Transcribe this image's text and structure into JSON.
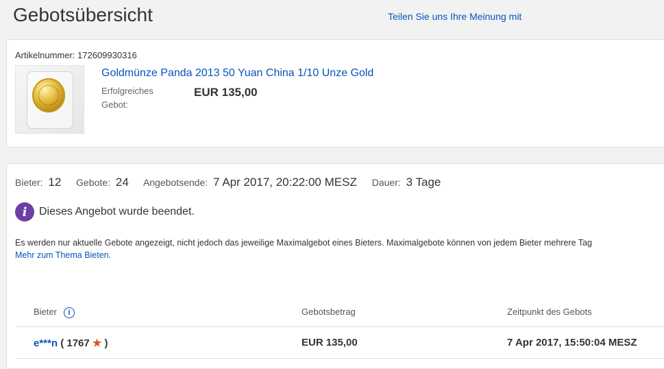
{
  "header": {
    "title": "Gebotsübersicht",
    "feedback_link": "Teilen Sie uns Ihre Meinung mit"
  },
  "item": {
    "number_label": "Artikelnummer: 172609930316",
    "title": "Goldmünze Panda 2013 50 Yuan China 1/10 Unze Gold",
    "sold_label": "Erfolgreiches Gebot:",
    "sold_price": "EUR 135,00"
  },
  "stats": {
    "bidders_label": "Bieter:",
    "bidders_value": "12",
    "bids_label": "Gebote:",
    "bids_value": "24",
    "end_label": "Angebotsende:",
    "end_value": "7 Apr 2017, 20:22:00 MESZ",
    "duration_label": "Dauer:",
    "duration_value": "3 Tage"
  },
  "status": {
    "message": "Dieses Angebot wurde beendet."
  },
  "note": {
    "text": "Es werden nur aktuelle Gebote angezeigt, nicht jedoch das jeweilige Maximalgebot eines Bieters. Maximalgebote können von jedem Bieter mehrere Tag",
    "link": "Mehr zum Thema Bieten."
  },
  "table": {
    "headers": {
      "bidder": "Bieter",
      "amount": "Gebotsbetrag",
      "time": "Zeitpunkt des Gebots"
    },
    "rows": [
      {
        "bidder": "e***n",
        "feedback_open": "(",
        "feedback": "1767",
        "feedback_close": ")",
        "amount": "EUR 135,00",
        "time": "7 Apr 2017, 15:50:04 MESZ"
      }
    ]
  },
  "colors": {
    "link": "#0654ba",
    "info_icon": "#6c3fa6",
    "star": "#d9531e",
    "gold": "#e8c145"
  },
  "icons": {
    "status": "info-circle-icon",
    "bidder_help": "info-outline-icon",
    "feedback_star": "star-icon",
    "coin": "gold-coin-image"
  }
}
